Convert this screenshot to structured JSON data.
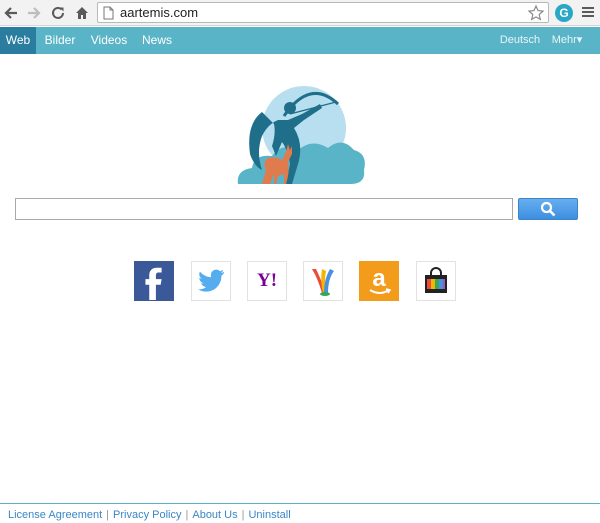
{
  "browser": {
    "url": "aartemis.com",
    "extension_letter": "G"
  },
  "sitebar": {
    "tabs": [
      {
        "label": "Web",
        "active": true
      },
      {
        "label": "Bilder",
        "active": false
      },
      {
        "label": "Videos",
        "active": false
      },
      {
        "label": "News",
        "active": false
      }
    ],
    "language": "Deutsch",
    "more": "Mehr▾"
  },
  "search": {
    "value": "",
    "button_icon": "search-icon"
  },
  "tiles": [
    {
      "name": "facebook",
      "icon": "facebook-icon",
      "color": "#3b5998"
    },
    {
      "name": "twitter",
      "icon": "twitter-bird-icon",
      "color": "#55acee"
    },
    {
      "name": "yahoo",
      "icon": "yahoo-icon",
      "color": "#7b0099",
      "text": "Y!"
    },
    {
      "name": "maps",
      "icon": "map-pin-icon",
      "color": "#4a90e2"
    },
    {
      "name": "amazon",
      "icon": "amazon-icon",
      "color": "#f39b1b",
      "text": "a"
    },
    {
      "name": "shopping",
      "icon": "shopping-bag-icon",
      "color": "#222222"
    }
  ],
  "footer": {
    "links": [
      "License Agreement",
      "Privacy Policy",
      "About Us",
      "Uninstall"
    ]
  },
  "colors": {
    "accent": "#5ab4c7",
    "active_tab": "#2a7d9e",
    "logo_primary": "#1f6f8b",
    "logo_secondary": "#e07b4e",
    "link": "#3a86c8"
  }
}
